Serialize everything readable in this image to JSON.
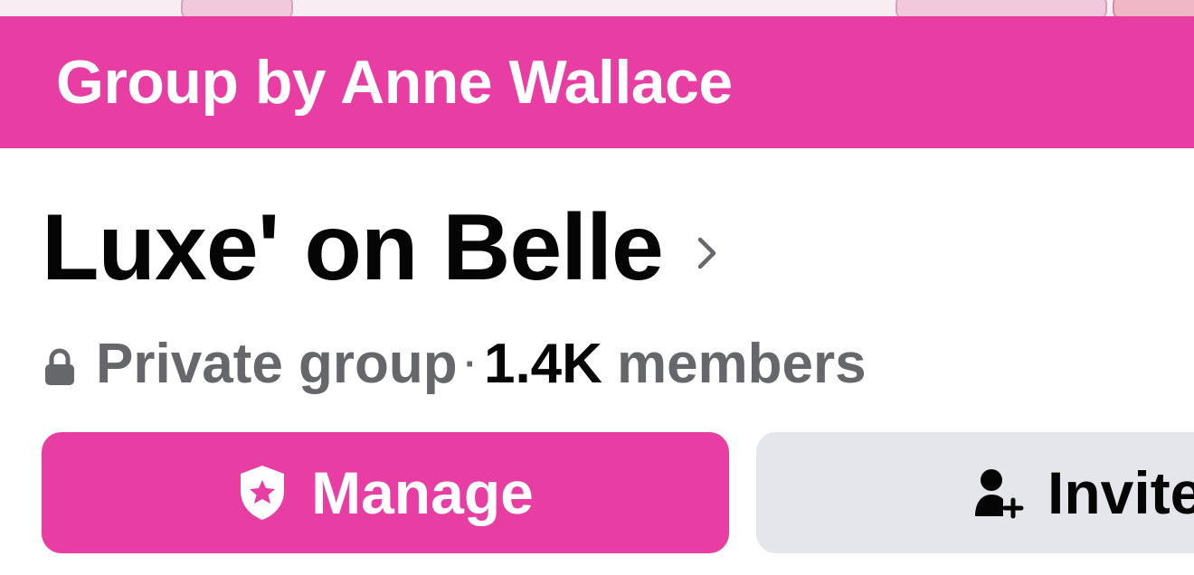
{
  "banner": {
    "text": "Group by Anne Wallace",
    "color": "#e83ea4"
  },
  "group": {
    "name": "Luxe' on Belle",
    "privacy": "Private group",
    "separator": "·",
    "member_count": "1.4K",
    "members_label": "members"
  },
  "actions": {
    "manage_label": "Manage",
    "manage_icon": "shield-star-icon",
    "invite_label": "Invite",
    "invite_icon": "add-person-icon"
  },
  "icons": {
    "lock": "lock-icon",
    "chevron": "chevron-right-icon"
  }
}
